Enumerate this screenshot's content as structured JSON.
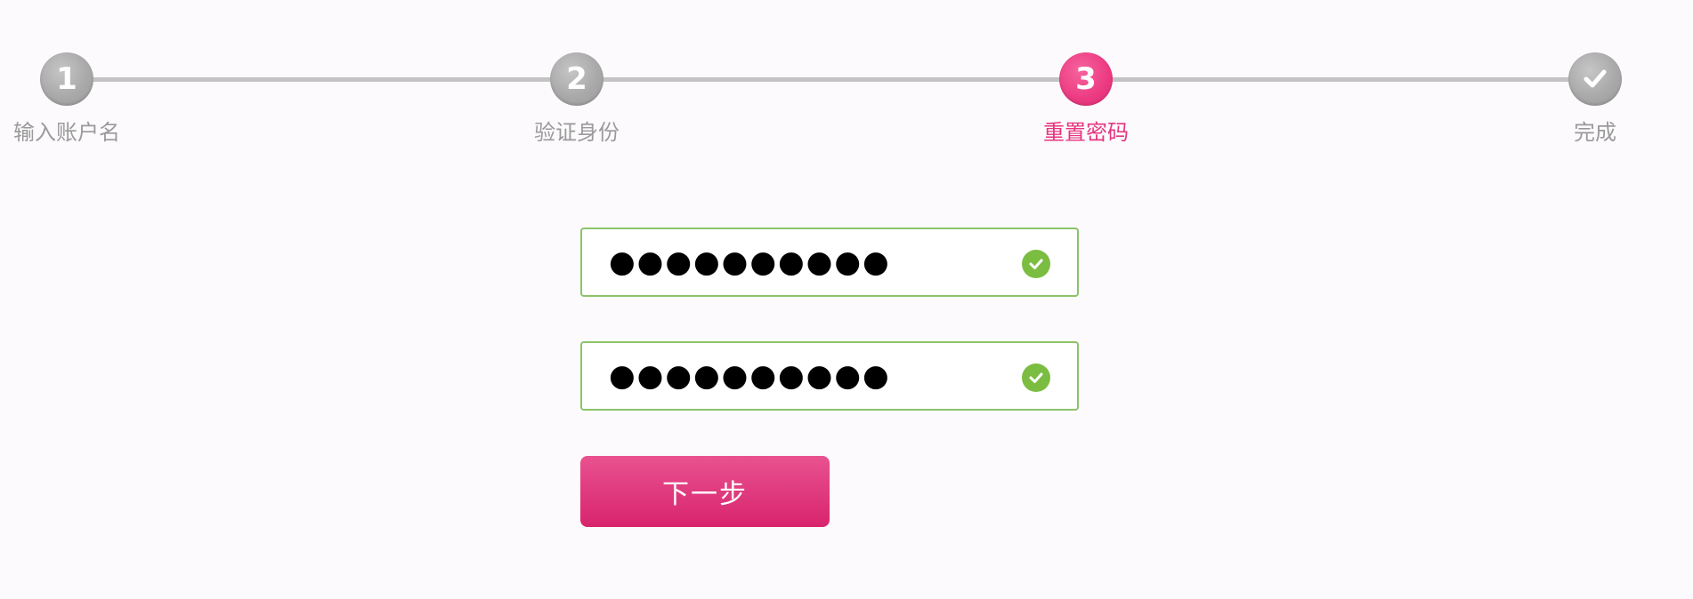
{
  "steps": [
    {
      "number": "1",
      "label": "输入账户名",
      "state": "done"
    },
    {
      "number": "2",
      "label": "验证身份",
      "state": "done"
    },
    {
      "number": "3",
      "label": "重置密码",
      "state": "active"
    },
    {
      "number": "✓",
      "label": "完成",
      "state": "pending"
    }
  ],
  "form": {
    "password": "●●●●●●●●●●",
    "confirm_password": "●●●●●●●●●●",
    "next_label": "下一步"
  },
  "colors": {
    "accent": "#e8357f",
    "step_gray": "#a9a9a9",
    "valid_green": "#7bbd41",
    "track": "#c3c3c3"
  },
  "icons": {
    "step4": "check-icon",
    "field_status": "check-circle-icon"
  }
}
